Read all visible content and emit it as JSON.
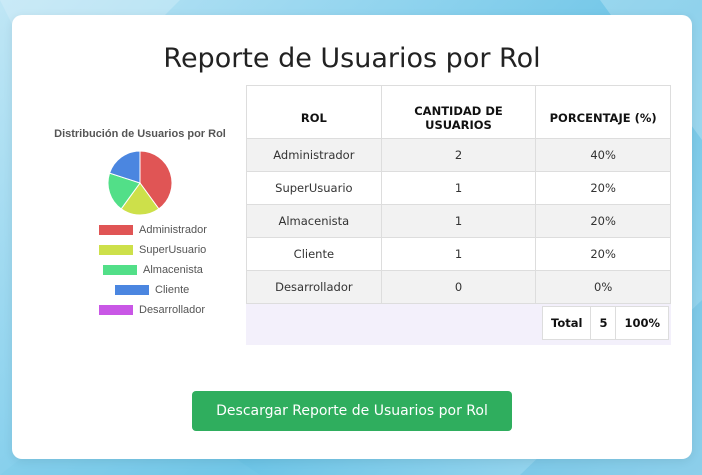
{
  "report": {
    "title": "Reporte de Usuarios por Rol",
    "download_label": "Descargar Reporte de Usuarios por Rol"
  },
  "chart_data": {
    "type": "pie",
    "title": "Distribución de Usuarios por Rol",
    "legend_position": "bottom",
    "slices": [
      {
        "label": "Administrador",
        "value": 2,
        "color": "#e05555"
      },
      {
        "label": "SuperUsuario",
        "value": 1,
        "color": "#cde04a"
      },
      {
        "label": "Almacenista",
        "value": 1,
        "color": "#52df88"
      },
      {
        "label": "Cliente",
        "value": 1,
        "color": "#4b86e0"
      },
      {
        "label": "Desarrollador",
        "value": 0,
        "color": "#c957e6"
      }
    ]
  },
  "table": {
    "headers": [
      "ROL",
      "CANTIDAD DE USUARIOS",
      "PORCENTAJE (%)"
    ],
    "rows": [
      {
        "rol": "Administrador",
        "cantidad": "2",
        "porcentaje": "40%"
      },
      {
        "rol": "SuperUsuario",
        "cantidad": "1",
        "porcentaje": "20%"
      },
      {
        "rol": "Almacenista",
        "cantidad": "1",
        "porcentaje": "20%"
      },
      {
        "rol": "Cliente",
        "cantidad": "1",
        "porcentaje": "20%"
      },
      {
        "rol": "Desarrollador",
        "cantidad": "0",
        "porcentaje": "0%"
      }
    ],
    "totals": {
      "label": "Total",
      "cantidad": "5",
      "porcentaje": "100%"
    }
  }
}
